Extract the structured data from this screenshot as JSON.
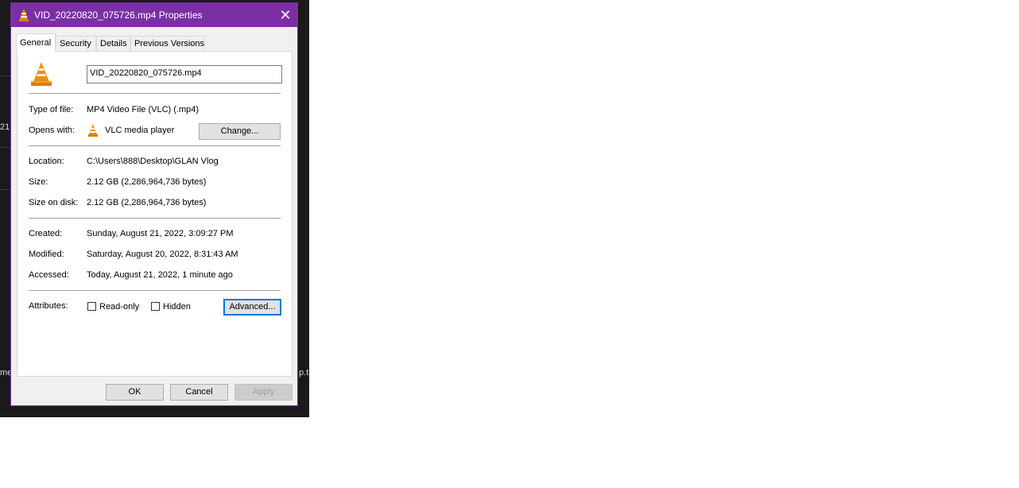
{
  "background": {
    "fragments": [
      "21",
      "me",
      "p.t"
    ]
  },
  "dialog": {
    "title": "VID_20220820_075726.mp4 Properties",
    "close_glyph": "✕",
    "tabs": [
      {
        "label": "General",
        "active": true
      },
      {
        "label": "Security",
        "active": false
      },
      {
        "label": "Details",
        "active": false
      },
      {
        "label": "Previous Versions",
        "active": false
      }
    ],
    "general": {
      "file_name": "VID_20220820_075726.mp4",
      "type_label": "Type of file:",
      "type_value": "MP4 Video File (VLC) (.mp4)",
      "opens_label": "Opens with:",
      "opens_value": "VLC media player",
      "change_button": "Change...",
      "location_label": "Location:",
      "location_value": "C:\\Users\\888\\Desktop\\GLAN Vlog",
      "size_label": "Size:",
      "size_value": "2.12 GB (2,286,964,736 bytes)",
      "size_on_disk_label": "Size on disk:",
      "size_on_disk_value": "2.12 GB (2,286,964,736 bytes)",
      "created_label": "Created:",
      "created_value": "Sunday, August 21, 2022, 3:09:27 PM",
      "modified_label": "Modified:",
      "modified_value": "Saturday, August 20, 2022, 8:31:43 AM",
      "accessed_label": "Accessed:",
      "accessed_value": "Today, August 21, 2022, 1 minute ago",
      "attributes_label": "Attributes:",
      "readonly_label": "Read-only",
      "readonly_checked": false,
      "hidden_label": "Hidden",
      "hidden_checked": false,
      "advanced_button": "Advanced..."
    },
    "buttons": {
      "ok": "OK",
      "cancel": "Cancel",
      "apply": "Apply"
    },
    "colors": {
      "titlebar": "#7b2fa5",
      "vlc_orange": "#f28c00"
    },
    "icons": [
      "vlc-cone-icon",
      "close-icon",
      "checkbox"
    ]
  }
}
